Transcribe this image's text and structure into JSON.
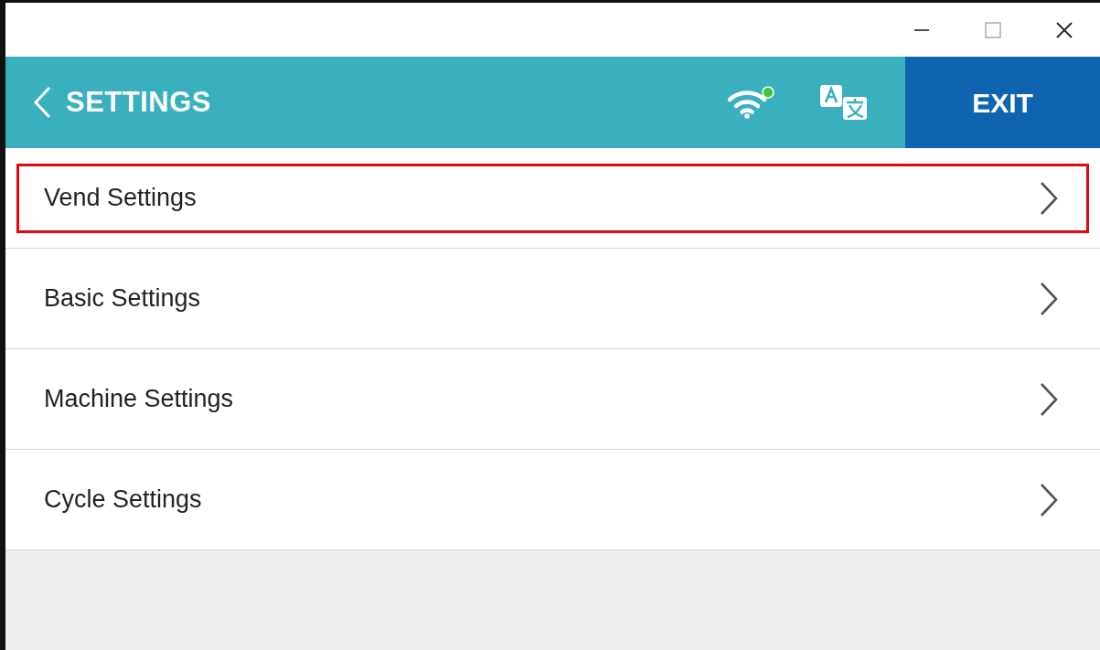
{
  "header": {
    "title": "SETTINGS",
    "wifi_connected": true,
    "exit_label": "EXIT"
  },
  "items": [
    {
      "label": "Vend Settings",
      "highlighted": true
    },
    {
      "label": "Basic Settings",
      "highlighted": false
    },
    {
      "label": "Machine Settings",
      "highlighted": false
    },
    {
      "label": "Cycle Settings",
      "highlighted": false
    }
  ]
}
